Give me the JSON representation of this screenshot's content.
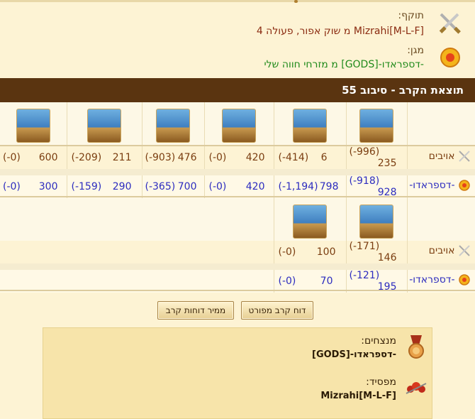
{
  "attacker": {
    "label": "תוקף:",
    "value": "Mizrahi[M-L-F] מ שוק אפור, פעולה 4"
  },
  "defender": {
    "label": "מגן:",
    "value": "-דספראדו-[GODS] מ מזרחי חווה שלי"
  },
  "result_header": "תוצאת הקרב - סיבוב 55",
  "rows": {
    "enemies_label": "אויבים",
    "mine_label": "-דספראדו-"
  },
  "block1": {
    "units": [
      "cannon-boat",
      "fire-ship",
      "ballista-ship",
      "catapult-ship",
      "target-mortar-ship",
      "mortar-ship"
    ],
    "enemies": [
      {
        "value": "235",
        "loss": "(-996)"
      },
      {
        "value": "6",
        "loss": "(-414)"
      },
      {
        "value": "420",
        "loss": "(-0)"
      },
      {
        "value": "476",
        "loss": "(-903)"
      },
      {
        "value": "211",
        "loss": "(-209)"
      },
      {
        "value": "600",
        "loss": "(-0)"
      }
    ],
    "mine": [
      {
        "value": "928",
        "loss": "(-918)"
      },
      {
        "value": "798",
        "loss": "(-1,194)"
      },
      {
        "value": "420",
        "loss": "(-0)"
      },
      {
        "value": "700",
        "loss": "(-365)"
      },
      {
        "value": "290",
        "loss": "(-159)"
      },
      {
        "value": "300",
        "loss": "(-0)"
      }
    ]
  },
  "block2": {
    "units": [
      "paddle-ship",
      "ram-ship"
    ],
    "enemies": [
      {
        "value": "146",
        "loss": "(-171)"
      },
      {
        "value": "100",
        "loss": "(-0)"
      }
    ],
    "mine": [
      {
        "value": "195",
        "loss": "(-121)"
      },
      {
        "value": "70",
        "loss": "(-0)"
      }
    ]
  },
  "buttons": {
    "detailed_report": "דוח קרב מפורט",
    "report_archive": "ממיר דוחות קרב"
  },
  "summary": {
    "winners_label": "מנצחים:",
    "winners_name": "-דספראדו-[GODS]",
    "losers_label": "מפסיד:",
    "losers_name": "Mizrahi[M-L-F]"
  },
  "colors": {
    "header_bg": "#5a3410",
    "page_bg": "#fdf3d4",
    "my_text": "#2c2cbf",
    "attacker_text": "#8a2a10",
    "defender_text": "#1f8a1a"
  }
}
